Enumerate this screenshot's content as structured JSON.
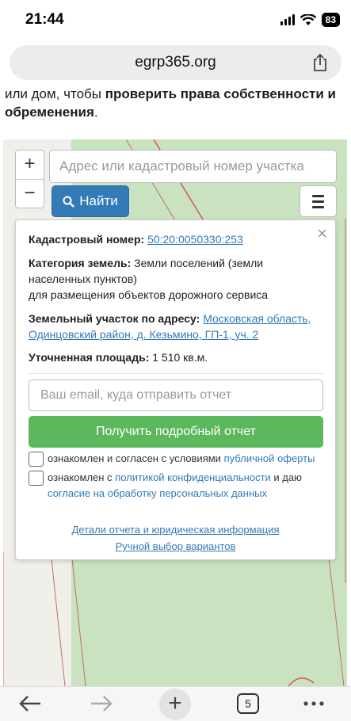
{
  "status": {
    "time": "21:44",
    "battery": "83"
  },
  "browser": {
    "url": "egrp365.org",
    "tabs_count": "5"
  },
  "page": {
    "intro_plain": "или дом, чтобы ",
    "intro_bold": "проверить права собственности и обременения",
    "intro_end": "."
  },
  "map": {
    "zoom_in": "+",
    "zoom_out": "−",
    "search_placeholder": "Адрес или кадастровый номер участка",
    "find_label": "Найти"
  },
  "popup": {
    "close": "×",
    "cadastral_label": "Кадастровый номер:",
    "cadastral_value": "50:20:0050330:253",
    "category_label": "Категория земель:",
    "category_value": "Земли поселений (земли населенных пунктов)",
    "category_use": "для размещения объектов дорожного сервиса",
    "address_label": "Земельный участок по адресу:",
    "address_value": "Московская область, Одинцовский район, д. Кезьмино, ГП-1, уч. 2",
    "area_label": "Уточненная площадь:",
    "area_value": "1 510 кв.м.",
    "email_placeholder": "Ваш email, куда отправить отчет",
    "report_button": "Получить подробный отчет",
    "consent1_text": "ознакомлен и согласен с условиями ",
    "consent1_link": "публичной оферты",
    "consent2_text": "ознакомлен с ",
    "consent2_link": "политикой конфиденциальности",
    "consent2_mid": " и даю ",
    "consent2_link2": "согласие на обработку персональных данных",
    "details_link": "Детали отчета и юридическая информация",
    "manual_link": "Ручной выбор вариантов"
  },
  "icons": {
    "signal": "signal-icon",
    "wifi": "wifi-icon",
    "share": "share-icon",
    "search": "search-icon",
    "menu": "menu-icon",
    "back": "back-arrow-icon",
    "forward": "forward-arrow-icon",
    "new_tab": "plus-icon",
    "more": "more-icon"
  },
  "colors": {
    "primary": "#337ab7",
    "success": "#5cb85c",
    "map_green": "#c9e3c0",
    "road_red": "#d9534f"
  }
}
